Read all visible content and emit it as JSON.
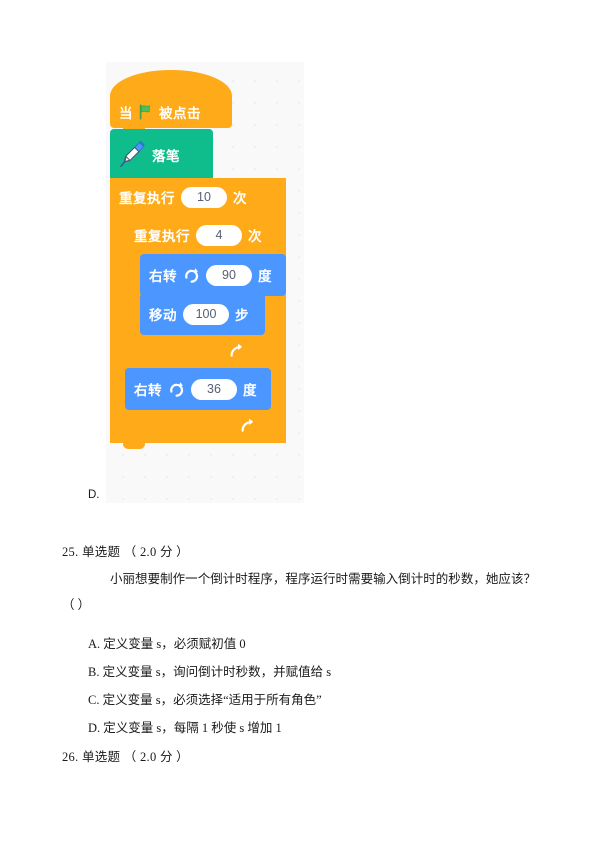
{
  "scratch_program": {
    "option_letter": "D.",
    "blocks": [
      {
        "id": "when-flag-clicked",
        "type": "hat",
        "color": "#FFAB19",
        "icon": "green-flag-icon",
        "text_before": "当",
        "text_after": "被点击"
      },
      {
        "id": "pen-down",
        "type": "stack",
        "color": "#0FBD8C",
        "icon": "pen-icon",
        "label": "落笔"
      },
      {
        "id": "repeat-outer",
        "type": "c-block",
        "color": "#FFAB19",
        "label_before": "重复执行",
        "value": "10",
        "label_after": "次",
        "loop_icon": "loop-arrow-icon"
      },
      {
        "id": "repeat-inner",
        "type": "c-block",
        "color": "#FFAB19",
        "label_before": "重复执行",
        "value": "4",
        "label_after": "次",
        "loop_icon": "loop-arrow-icon"
      },
      {
        "id": "turn-right-90",
        "type": "stack",
        "color": "#4C97FF",
        "label_before": "右转",
        "icon": "turn-clockwise-icon",
        "value": "90",
        "label_after": "度"
      },
      {
        "id": "move-100",
        "type": "stack",
        "color": "#4C97FF",
        "label_before": "移动",
        "value": "100",
        "label_after": "步"
      },
      {
        "id": "turn-right-36",
        "type": "stack",
        "color": "#4C97FF",
        "label_before": "右转",
        "icon": "turn-clockwise-icon",
        "value": "36",
        "label_after": "度"
      }
    ]
  },
  "questions": [
    {
      "number": "25.",
      "type_label": "单选题",
      "points": "（ 2.0 分 ）",
      "header": "25. 单选题  （ 2.0 分 ）",
      "stem": "小丽想要制作一个倒计时程序，程序运行时需要输入倒计时的秒数，她应该？（ ）",
      "options": [
        "A. 定义变量 s，必须赋初值 0",
        "B. 定义变量 s，询问倒计时秒数，并赋值给 s",
        "C. 定义变量 s，必须选择“适用于所有角色”",
        "D. 定义变量 s，每隔 1 秒使 s 增加 1"
      ]
    },
    {
      "number": "26.",
      "type_label": "单选题",
      "points": "（ 2.0 分 ）",
      "header": "26. 单选题  （ 2.0 分 ）",
      "stem": "",
      "options": []
    }
  ],
  "colors": {
    "event_block": "#FFAB19",
    "pen_block": "#0FBD8C",
    "motion_block": "#4C97FF",
    "canvas_background": "#F9F9F9",
    "page_background": "#FFFFFF",
    "text": "#1A1A1A"
  }
}
